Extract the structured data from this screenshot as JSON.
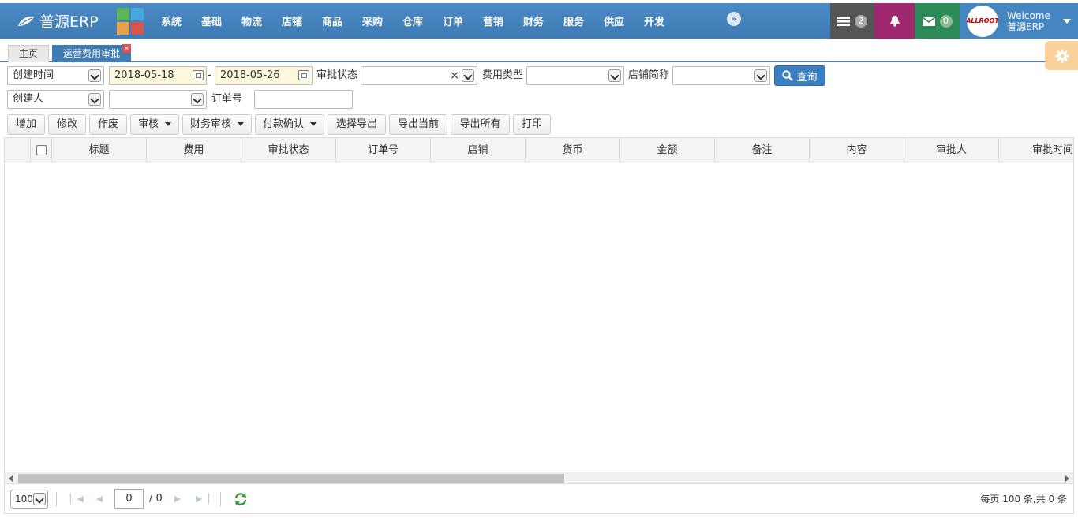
{
  "app": {
    "title": "普源ERP",
    "nav": [
      "系统",
      "基础",
      "物流",
      "店铺",
      "商品",
      "采购",
      "仓库",
      "订单",
      "营销",
      "财务",
      "服务",
      "供应",
      "开发"
    ],
    "tasks_count": "2",
    "mail_count": "0",
    "avatar_text": "ALLROOT",
    "welcome": "Welcome",
    "username": "普源ERP"
  },
  "tabs": {
    "home": "主页",
    "active": "运营费用审批"
  },
  "filters": {
    "date_field": "创建时间",
    "date_from": "2018-05-18",
    "date_sep": "-",
    "date_to": "2018-05-26",
    "approval_status_label": "审批状态",
    "approval_status_value": "",
    "fee_type_label": "费用类型",
    "fee_type_value": "",
    "store_label": "店铺简称",
    "store_value": "",
    "query_button": "查询",
    "person_field": "创建人",
    "person_value": "",
    "order_no_label": "订单号",
    "order_no_value": ""
  },
  "toolbar": {
    "add": "增加",
    "edit": "修改",
    "void": "作废",
    "audit": "审核",
    "finance_audit": "财务审核",
    "payment_confirm": "付款确认",
    "export_selected": "选择导出",
    "export_current": "导出当前",
    "export_all": "导出所有",
    "print": "打印"
  },
  "grid": {
    "columns": [
      "标题",
      "费用",
      "审批状态",
      "订单号",
      "店铺",
      "货币",
      "金额",
      "备注",
      "内容",
      "审批人",
      "审批时间"
    ],
    "rows": []
  },
  "pager": {
    "page_size": "100",
    "current_page": "0",
    "total_pages": "/ 0",
    "summary": "每页 100 条,共 0 条"
  },
  "colors": {
    "nav_bg": "#3f7bb4",
    "tasks_bg": "#555555",
    "bell_bg": "#a0286e",
    "mail_bg": "#2b8a57",
    "date_bg": "#fdf7dd",
    "query_bg": "#3c7fc0",
    "gear_bg": "#f8d29a"
  }
}
